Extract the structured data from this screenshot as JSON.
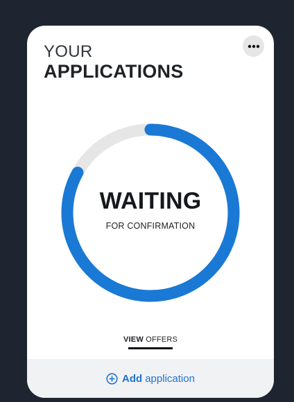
{
  "card": {
    "title_line1": "YOUR",
    "title_line2": "APPLICATIONS",
    "more_icon": "more-horizontal-icon"
  },
  "progress": {
    "fraction": 0.83,
    "track_color": "#e6e6e6",
    "fill_color": "#1a79d4",
    "status": "WAITING",
    "status_sub": "FOR CONFIRMATION"
  },
  "view_offers": {
    "bold": "VIEW",
    "rest": "OFFERS"
  },
  "footer": {
    "icon": "plus-circle-icon",
    "bold": "Add",
    "rest": "application"
  }
}
